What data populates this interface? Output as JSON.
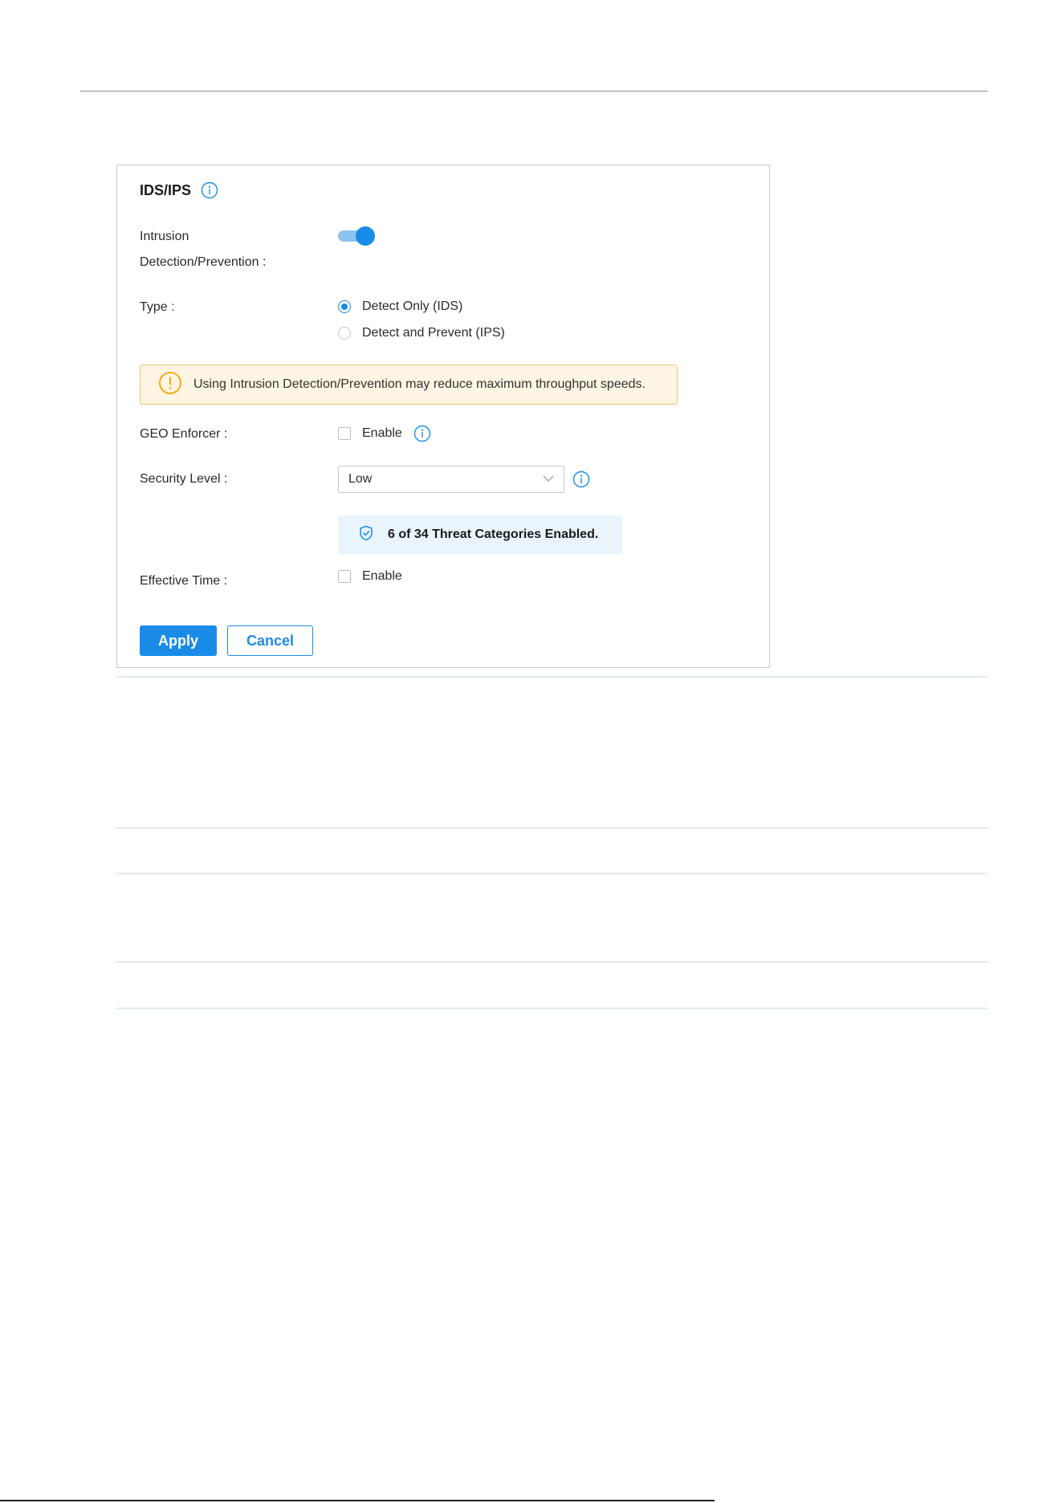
{
  "panel": {
    "title": "IDS/IPS",
    "intrusion_label_line1": "Intrusion",
    "intrusion_label_line2": "Detection/Prevention :",
    "intrusion_enabled": true,
    "type_label": "Type :",
    "type_options": [
      {
        "label": "Detect Only (IDS)",
        "checked": true
      },
      {
        "label": "Detect and Prevent (IPS)",
        "checked": false
      }
    ],
    "warning_text": "Using Intrusion Detection/Prevention may reduce maximum throughput speeds.",
    "geo_label": "GEO Enforcer :",
    "geo_enable_label": "Enable",
    "geo_enabled": false,
    "security_level_label": "Security Level :",
    "security_level_value": "Low",
    "threat_summary": "6 of 34 Threat Categories Enabled.",
    "effective_time_label": "Effective Time :",
    "effective_enable_label": "Enable",
    "effective_enabled": false,
    "apply_label": "Apply",
    "cancel_label": "Cancel"
  },
  "colors": {
    "accent": "#1a8ce8",
    "warning_bg": "#fdf4e3",
    "warning_border": "#f0c373",
    "warning_icon": "#f2a900",
    "threat_bg": "#e9f4fc"
  },
  "icons": {
    "title_info": "info-icon",
    "geo_info": "info-icon",
    "security_info": "info-icon",
    "warning": "warning-icon",
    "threat": "shield-check-icon",
    "select_arrow": "chevron-down-icon"
  }
}
